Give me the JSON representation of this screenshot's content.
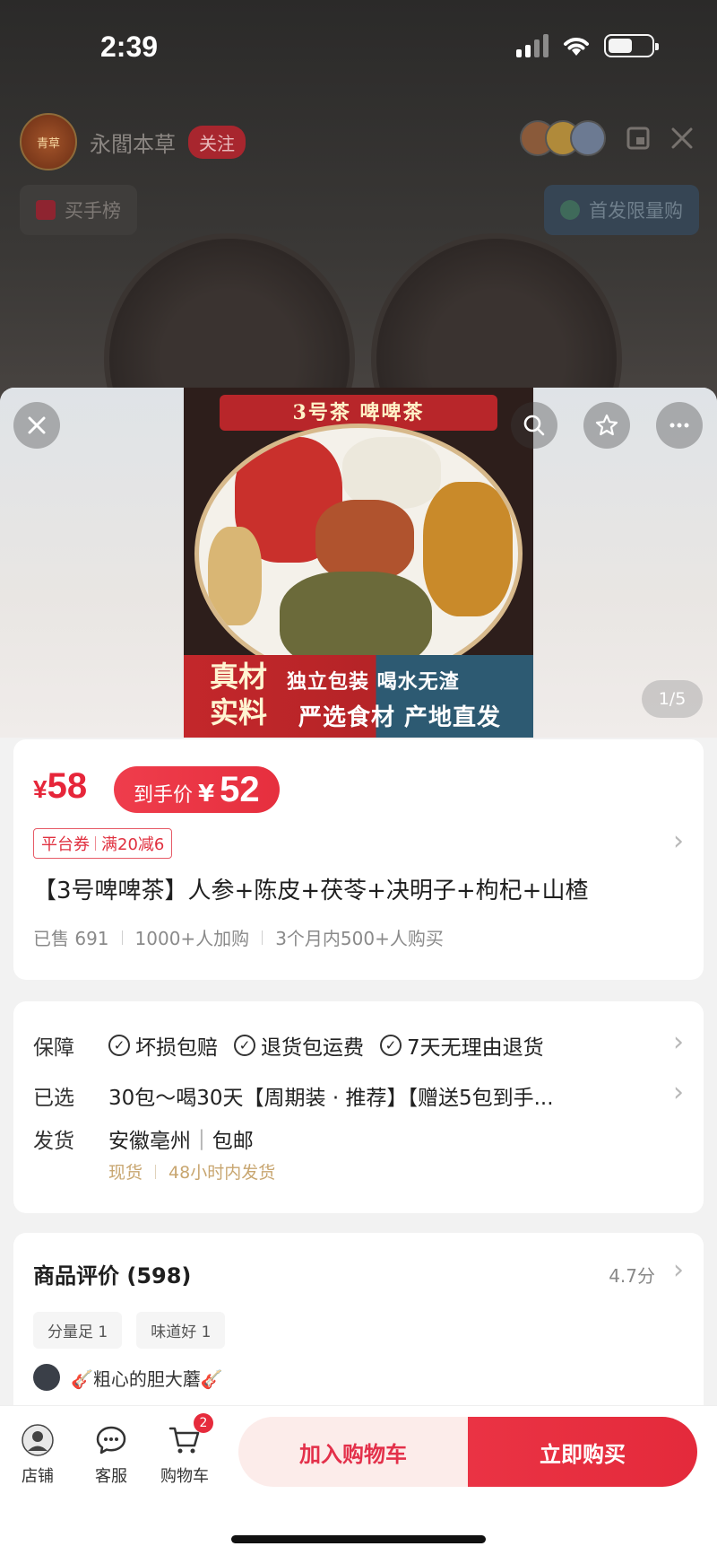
{
  "status": {
    "time": "2:39"
  },
  "live": {
    "shop_name": "永閻本草",
    "follow_label": "关注",
    "avatar_text": "青草",
    "badge_left": "买手榜",
    "badge_right": "首发限量购"
  },
  "gallery": {
    "banner": "3号茶 啤啤茶",
    "real_label_1": "真材",
    "real_label_2": "实料",
    "line1": "独立包装 喝水无渣",
    "line2": "严选食材 产地直发",
    "page_indicator": "1/5"
  },
  "price": {
    "currency": "¥",
    "price": "58",
    "pill_label": "到手价",
    "pill_currency": "¥",
    "pill_value": "52",
    "coupon_type": "平台券",
    "coupon_value": "满20减6"
  },
  "product": {
    "title": "【3号啤啤茶】人参+陈皮+茯苓+决明子+枸杞+山楂",
    "sold": "已售 691",
    "added": "1000+人加购",
    "bought": "3个月内500+人购买"
  },
  "service": {
    "guarantee_key": "保障",
    "guarantees": [
      "坏损包赔",
      "退货包运费",
      "7天无理由退货"
    ],
    "selected_key": "已选",
    "selected_value": "30包～喝30天【周期装 · 推荐】【赠送5包到手...",
    "ship_key": "发货",
    "ship_from": "安徽亳州",
    "ship_free": "包邮",
    "stock": "现货",
    "ship_time": "48小时内发货"
  },
  "reviews": {
    "title": "商品评价 (598)",
    "score": "4.7分",
    "tags": [
      "分量足 1",
      "味道好 1"
    ],
    "first_user": "🎸粗心的胆大蘑🎸"
  },
  "bottom": {
    "shop_label": "店铺",
    "service_label": "客服",
    "cart_label": "购物车",
    "cart_count": "2",
    "add_cart": "加入购物车",
    "buy_now": "立即购买"
  }
}
